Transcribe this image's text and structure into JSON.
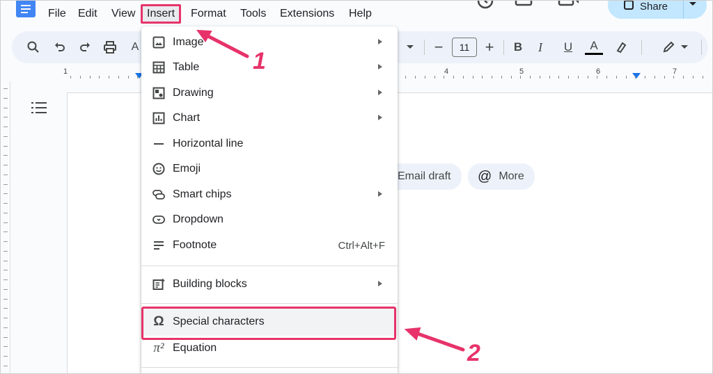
{
  "menubar": {
    "items": [
      "File",
      "Edit",
      "View",
      "Insert",
      "Format",
      "Tools",
      "Extensions",
      "Help"
    ],
    "share_label": "Share"
  },
  "toolbar": {
    "font_size": "11",
    "bold": "B",
    "italic": "I",
    "underline": "U",
    "text_color": "A"
  },
  "ruler": {
    "numbers": [
      "1",
      "4",
      "5",
      "6",
      "7"
    ]
  },
  "chips": {
    "email_draft": "Email draft",
    "more": "More"
  },
  "insert_menu": {
    "items": [
      {
        "label": "Image",
        "icon": "image-icon",
        "submenu": true
      },
      {
        "label": "Table",
        "icon": "table-icon",
        "submenu": true
      },
      {
        "label": "Drawing",
        "icon": "drawing-icon",
        "submenu": true
      },
      {
        "label": "Chart",
        "icon": "chart-icon",
        "submenu": true
      },
      {
        "label": "Horizontal line",
        "icon": "horizontal-line-icon",
        "submenu": false
      },
      {
        "label": "Emoji",
        "icon": "emoji-icon",
        "submenu": false
      },
      {
        "label": "Smart chips",
        "icon": "smart-chips-icon",
        "submenu": true
      },
      {
        "label": "Dropdown",
        "icon": "dropdown-icon",
        "submenu": false
      },
      {
        "label": "Footnote",
        "icon": "footnote-icon",
        "submenu": false,
        "shortcut": "Ctrl+Alt+F"
      },
      {
        "label": "Building blocks",
        "icon": "building-blocks-icon",
        "submenu": true
      },
      {
        "label": "Special characters",
        "icon": "omega-icon",
        "submenu": false
      },
      {
        "label": "Equation",
        "icon": "pi-icon",
        "submenu": false
      }
    ]
  },
  "annotations": {
    "step1": "1",
    "step2": "2",
    "color": "#e7336a"
  },
  "colors": {
    "accent": "#1a73e8",
    "highlight": "#e7336a",
    "share_bg": "#c2e7ff",
    "toolbar_bg": "#edf2fa"
  }
}
